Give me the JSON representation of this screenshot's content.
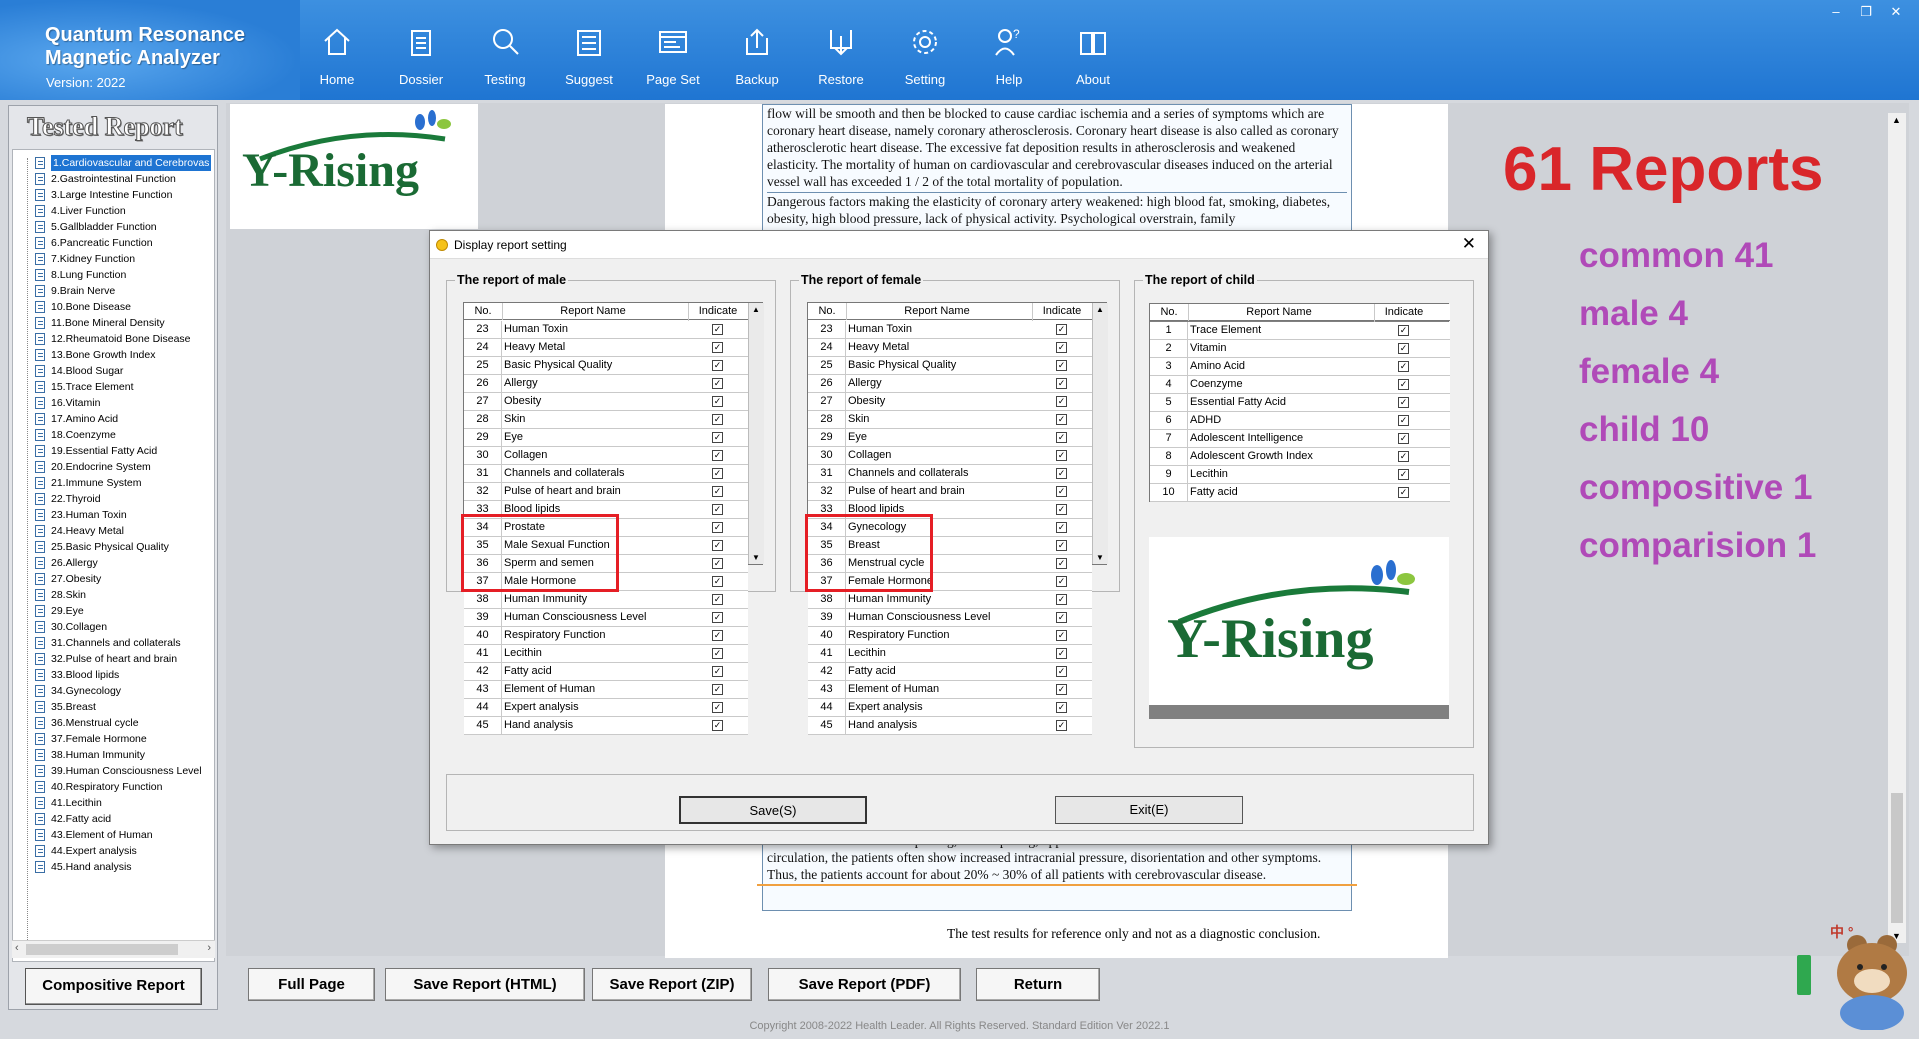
{
  "app": {
    "title_line1": "Quantum Resonance",
    "title_line2": "Magnetic Analyzer",
    "version": "Version: 2022"
  },
  "nav": [
    {
      "label": "Home",
      "icon": "home-icon"
    },
    {
      "label": "Dossier",
      "icon": "clipboard-icon"
    },
    {
      "label": "Testing",
      "icon": "magnifier-icon"
    },
    {
      "label": "Suggest",
      "icon": "list-icon"
    },
    {
      "label": "Page Set",
      "icon": "page-set-icon"
    },
    {
      "label": "Backup",
      "icon": "upload-icon"
    },
    {
      "label": "Restore",
      "icon": "download-icon"
    },
    {
      "label": "Setting",
      "icon": "gear-icon"
    },
    {
      "label": "Help",
      "icon": "help-icon"
    },
    {
      "label": "About",
      "icon": "book-icon"
    }
  ],
  "window_controls": {
    "minimize": "–",
    "restore": "❐",
    "close": "✕"
  },
  "left": {
    "title": "Tested Report",
    "items": [
      "1.Cardiovascular and Cerebrovas",
      "2.Gastrointestinal Function",
      "3.Large Intestine Function",
      "4.Liver Function",
      "5.Gallbladder Function",
      "6.Pancreatic Function",
      "7.Kidney Function",
      "8.Lung Function",
      "9.Brain Nerve",
      "10.Bone Disease",
      "11.Bone Mineral Density",
      "12.Rheumatoid Bone Disease",
      "13.Bone Growth Index",
      "14.Blood Sugar",
      "15.Trace Element",
      "16.Vitamin",
      "17.Amino Acid",
      "18.Coenzyme",
      "19.Essential Fatty Acid",
      "20.Endocrine System",
      "21.Immune System",
      "22.Thyroid",
      "23.Human Toxin",
      "24.Heavy Metal",
      "25.Basic Physical Quality",
      "26.Allergy",
      "27.Obesity",
      "28.Skin",
      "29.Eye",
      "30.Collagen",
      "31.Channels and collaterals",
      "32.Pulse of heart and brain",
      "33.Blood lipids",
      "34.Gynecology",
      "35.Breast",
      "36.Menstrual cycle",
      "37.Female Hormone",
      "38.Human Immunity",
      "39.Human Consciousness Level",
      "40.Respiratory Function",
      "41.Lecithin",
      "42.Fatty acid",
      "43.Element of Human",
      "44.Expert analysis",
      "45.Hand analysis"
    ],
    "compositive_button": "Compositive Report"
  },
  "logo_text": "Y-Rising",
  "report": {
    "text_top": "flow will be smooth and then be blocked to cause cardiac ischemia and a series of symptoms which are coronary heart disease, namely coronary atherosclerosis. Coronary heart disease is also called as coronary atherosclerotic heart disease. The excessive fat deposition results in atherosclerosis and weakened elasticity. The mortality of human on cardiovascular and cerebrovascular diseases induced on the arterial vessel wall has exceeded 1 / 2 of the total mortality of population.",
    "text_top2": "Dangerous factors making the elasticity of coronary artery weakened: high blood fat, smoking, diabetes, obesity, high blood pressure, lack of physical activity. Psychological overstrain, family",
    "text_bottom": "ischemic or blood vessel rupturing, blood spilling, oppression on brain tissue and blocked blood circulation, the patients often show increased intracranial pressure, disorientation and other symptoms. Thus, the patients account for about 20% ~ 30% of all patients with cerebrovascular disease.",
    "disclaimer": "The test results for reference only and not as a diagnostic conclusion."
  },
  "stats": {
    "headline": "61 Reports",
    "lines": [
      "common 41",
      "male 4",
      "female 4",
      "child 10",
      "compositive 1",
      "comparision 1"
    ]
  },
  "bottom_buttons": [
    "Full Page",
    "Save Report (HTML)",
    "Save Report (ZIP)",
    "Save Report (PDF)",
    "Return"
  ],
  "copyright": "Copyright 2008-2022 Health Leader. All Rights Reserved.  Standard Edition Ver 2022.1",
  "ime": "中 °",
  "dialog": {
    "title": "Display report setting",
    "close": "✕",
    "headers": {
      "no": "No.",
      "name": "Report Name",
      "indicate": "Indicate"
    },
    "check": "✓",
    "male": {
      "label": "The report of male",
      "rows": [
        [
          "23",
          "Human Toxin"
        ],
        [
          "24",
          "Heavy Metal"
        ],
        [
          "25",
          "Basic Physical Quality"
        ],
        [
          "26",
          "Allergy"
        ],
        [
          "27",
          "Obesity"
        ],
        [
          "28",
          "Skin"
        ],
        [
          "29",
          "Eye"
        ],
        [
          "30",
          "Collagen"
        ],
        [
          "31",
          "Channels and collaterals"
        ],
        [
          "32",
          "Pulse of heart and brain"
        ],
        [
          "33",
          "Blood lipids"
        ],
        [
          "34",
          "Prostate"
        ],
        [
          "35",
          "Male Sexual Function"
        ],
        [
          "36",
          "Sperm and semen"
        ],
        [
          "37",
          "Male Hormone"
        ],
        [
          "38",
          "Human Immunity"
        ],
        [
          "39",
          "Human Consciousness Level"
        ],
        [
          "40",
          "Respiratory Function"
        ],
        [
          "41",
          "Lecithin"
        ],
        [
          "42",
          "Fatty acid"
        ],
        [
          "43",
          "Element of Human"
        ],
        [
          "44",
          "Expert analysis"
        ],
        [
          "45",
          "Hand analysis"
        ]
      ]
    },
    "female": {
      "label": "The report of female",
      "rows": [
        [
          "23",
          "Human Toxin"
        ],
        [
          "24",
          "Heavy Metal"
        ],
        [
          "25",
          "Basic Physical Quality"
        ],
        [
          "26",
          "Allergy"
        ],
        [
          "27",
          "Obesity"
        ],
        [
          "28",
          "Skin"
        ],
        [
          "29",
          "Eye"
        ],
        [
          "30",
          "Collagen"
        ],
        [
          "31",
          "Channels and collaterals"
        ],
        [
          "32",
          "Pulse of heart and brain"
        ],
        [
          "33",
          "Blood lipids"
        ],
        [
          "34",
          "Gynecology"
        ],
        [
          "35",
          "Breast"
        ],
        [
          "36",
          "Menstrual cycle"
        ],
        [
          "37",
          "Female Hormone"
        ],
        [
          "38",
          "Human Immunity"
        ],
        [
          "39",
          "Human Consciousness Level"
        ],
        [
          "40",
          "Respiratory Function"
        ],
        [
          "41",
          "Lecithin"
        ],
        [
          "42",
          "Fatty acid"
        ],
        [
          "43",
          "Element of Human"
        ],
        [
          "44",
          "Expert analysis"
        ],
        [
          "45",
          "Hand analysis"
        ]
      ]
    },
    "child": {
      "label": "The report of child",
      "rows": [
        [
          "1",
          "Trace Element"
        ],
        [
          "2",
          "Vitamin"
        ],
        [
          "3",
          "Amino Acid"
        ],
        [
          "4",
          "Coenzyme"
        ],
        [
          "5",
          "Essential Fatty Acid"
        ],
        [
          "6",
          "ADHD"
        ],
        [
          "7",
          "Adolescent Intelligence"
        ],
        [
          "8",
          "Adolescent Growth Index"
        ],
        [
          "9",
          "Lecithin"
        ],
        [
          "10",
          "Fatty acid"
        ]
      ]
    },
    "save_button": "Save(S)",
    "exit_button": "Exit(E)"
  },
  "colors": {
    "topbar": "#1f75d2",
    "highlight": "#e51e25",
    "headline": "#d9262a",
    "stats": "#b04ab8",
    "brand_green": "#1a7a3a"
  }
}
